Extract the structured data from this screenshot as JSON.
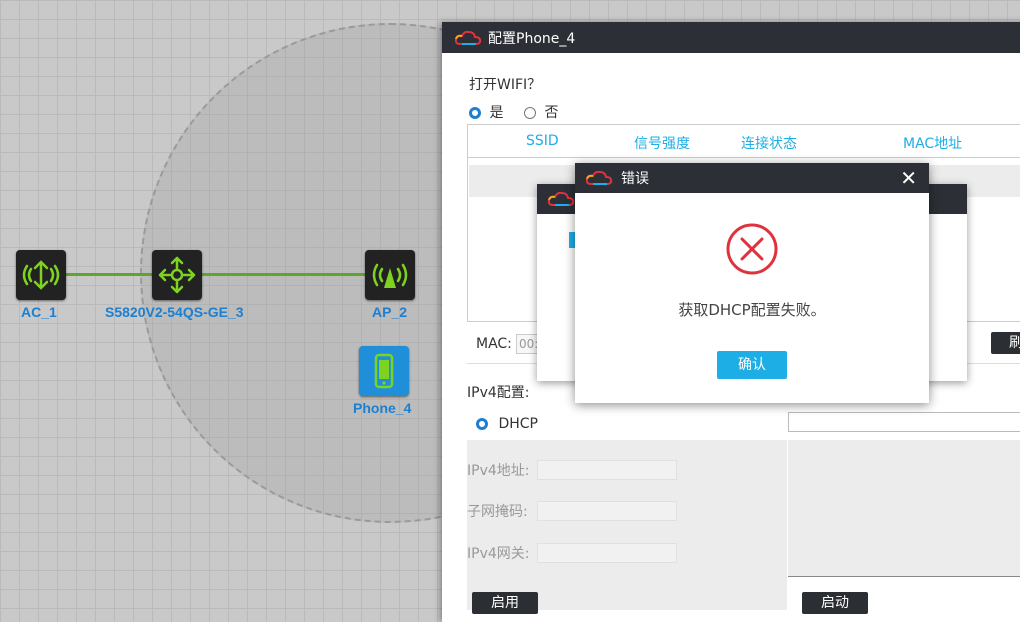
{
  "topology": {
    "nodes": [
      {
        "label": "AC_1",
        "icon": "wireless-ac-icon"
      },
      {
        "label": "S5820V2-54QS-GE_3",
        "icon": "switch-icon"
      },
      {
        "label": "AP_2",
        "icon": "access-point-icon"
      },
      {
        "label": "Phone_4",
        "icon": "phone-icon"
      }
    ]
  },
  "config_window": {
    "title": "配置Phone_4",
    "wifi_question": "打开WIFI？",
    "wifi_yes": "是",
    "wifi_no": "否",
    "table_headers": [
      "SSID",
      "信号强度",
      "连接状态",
      "MAC地址"
    ],
    "mac_label": "MAC:",
    "mac_value": "00:",
    "refresh_button": "刷",
    "ipv4_section": "IPv4配置:",
    "dhcp_label": "DHCP",
    "ipv4_address_label": "IPv4地址:",
    "subnet_mask_label": "子网掩码:",
    "ipv4_gateway_label": "IPv4网关:",
    "enable_button": "启用",
    "start_button": "启动"
  },
  "error_dialog": {
    "title": "错误",
    "message": "获取DHCP配置失败。",
    "ok_button": "确认"
  },
  "colors": {
    "title_bar": "#2c3036",
    "accent": "#1eaee6",
    "error_red": "#e0323e",
    "link_green": "#5ea52a",
    "node_label": "#1d7fd0"
  }
}
